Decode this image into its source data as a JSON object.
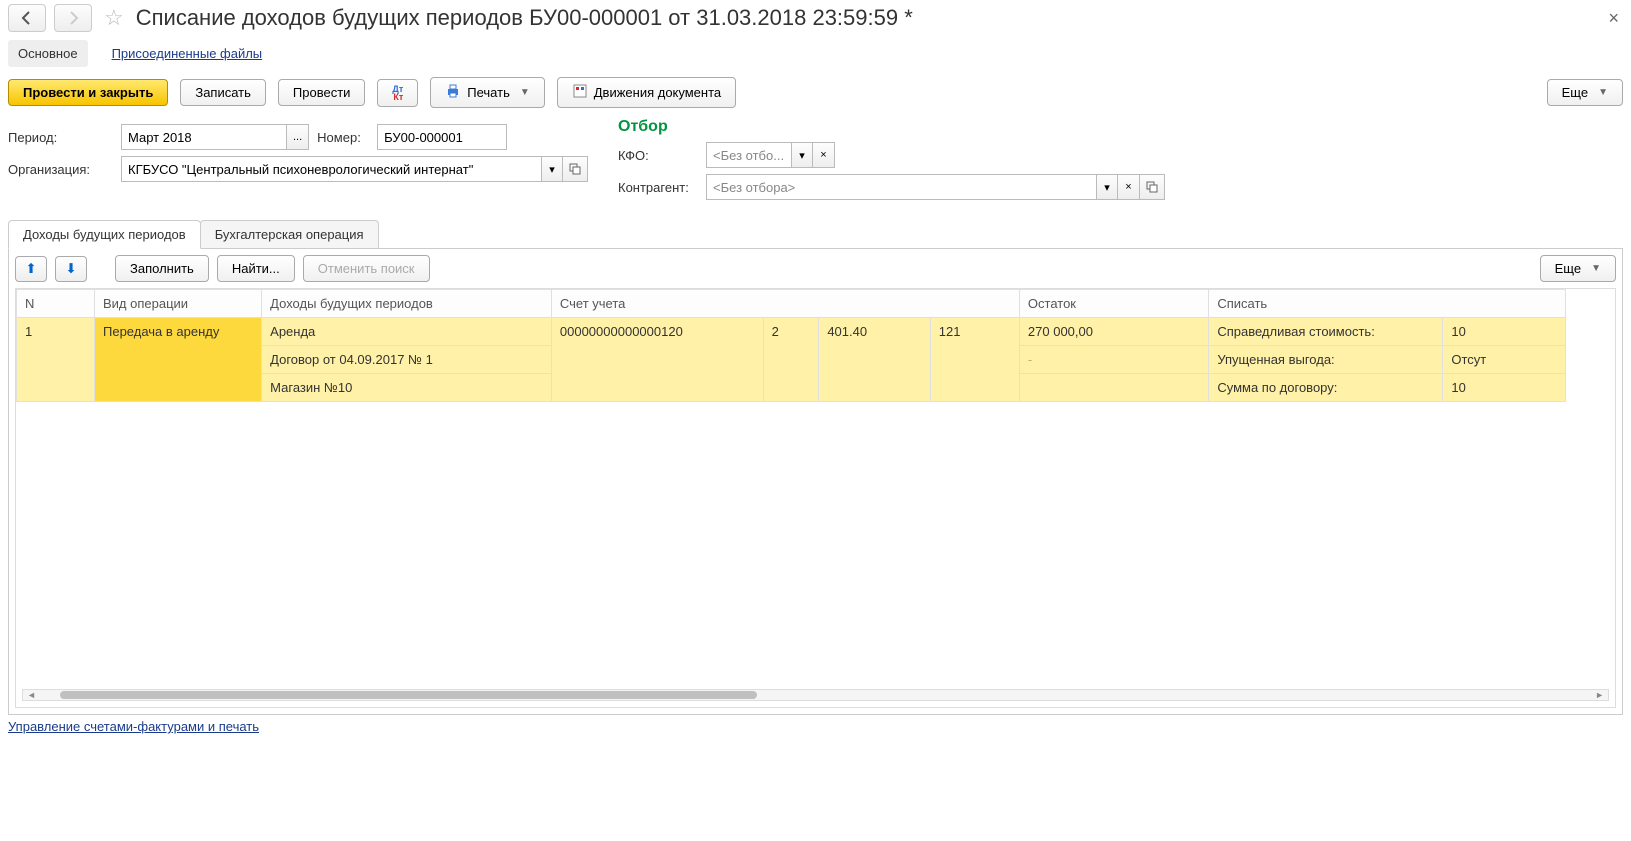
{
  "header": {
    "title": "Списание доходов будущих периодов БУ00-000001 от 31.03.2018 23:59:59 *"
  },
  "link_tabs": {
    "main": "Основное",
    "attachments": "Присоединенные файлы"
  },
  "toolbar": {
    "post_close": "Провести и закрыть",
    "save": "Записать",
    "post": "Провести",
    "print": "Печать",
    "movements": "Движения документа",
    "more": "Еще"
  },
  "form": {
    "period_label": "Период:",
    "period_value": "Март 2018",
    "number_label": "Номер:",
    "number_value": "БУ00-000001",
    "org_label": "Организация:",
    "org_value": "КГБУСО \"Центральный психоневрологический интернат\""
  },
  "filter": {
    "title": "Отбор",
    "kfo_label": "КФО:",
    "kfo_placeholder": "<Без отбо...",
    "contr_label": "Контрагент:",
    "contr_placeholder": "<Без отбора>"
  },
  "tabs": {
    "incomes": "Доходы будущих периодов",
    "accounting": "Бухгалтерская операция"
  },
  "tab_toolbar": {
    "fill": "Заполнить",
    "find": "Найти...",
    "cancel_find": "Отменить поиск",
    "more": "Еще"
  },
  "grid": {
    "headers": {
      "n": "N",
      "op_type": "Вид операции",
      "future_income": "Доходы будущих периодов",
      "account": "Счет учета",
      "balance": "Остаток",
      "writeoff": "Списать"
    },
    "row1": {
      "n": "1",
      "op_type": "Передача в аренду",
      "income_1": "Аренда",
      "income_2": "Договор от 04.09.2017 № 1",
      "income_3": "Магазин №10",
      "account_code": "00000000000000120",
      "account_sub1": "2",
      "account_sub2": "401.40",
      "account_sub3": "121",
      "balance": "270 000,00",
      "balance_dash": "-",
      "writeoff_1_label": "Справедливая стоимость:",
      "writeoff_1_val": "10",
      "writeoff_2_label": "Упущенная выгода:",
      "writeoff_2_val": "Отсут",
      "writeoff_3_label": "Сумма по договору:",
      "writeoff_3_val": "10"
    }
  },
  "footer": {
    "link": "Управление счетами-фактурами и печать"
  }
}
